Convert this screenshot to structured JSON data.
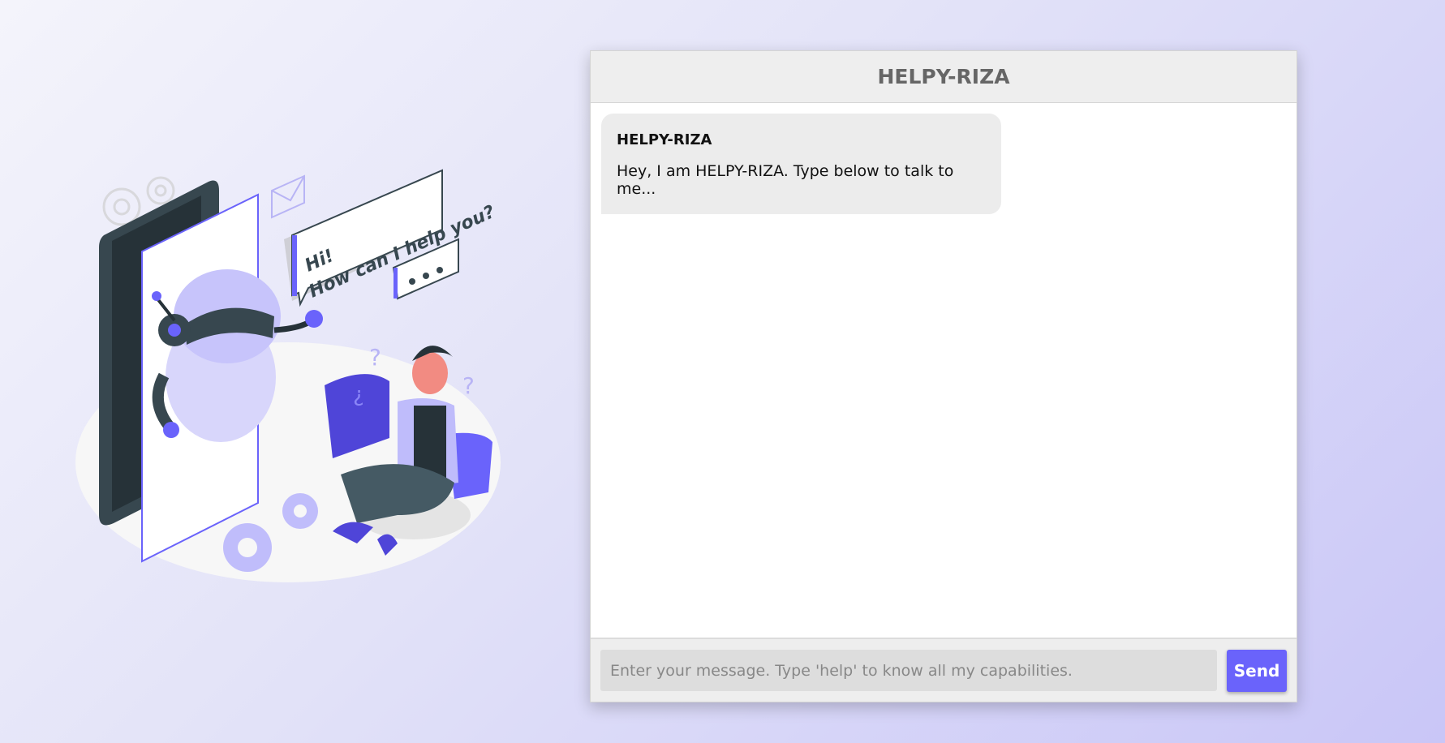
{
  "chat": {
    "title": "HELPY-RIZA",
    "messages": [
      {
        "name": "HELPY-RIZA",
        "text": "Hey, I am HELPY-RIZA. Type below to talk to me..."
      }
    ],
    "input_placeholder": "Enter your message. Type 'help' to know all my capabilities.",
    "send_label": "Send"
  },
  "illustration": {
    "bubble_line1": "Hi!",
    "bubble_line2": "How can I help you?",
    "accent_color": "#6a63fb"
  }
}
